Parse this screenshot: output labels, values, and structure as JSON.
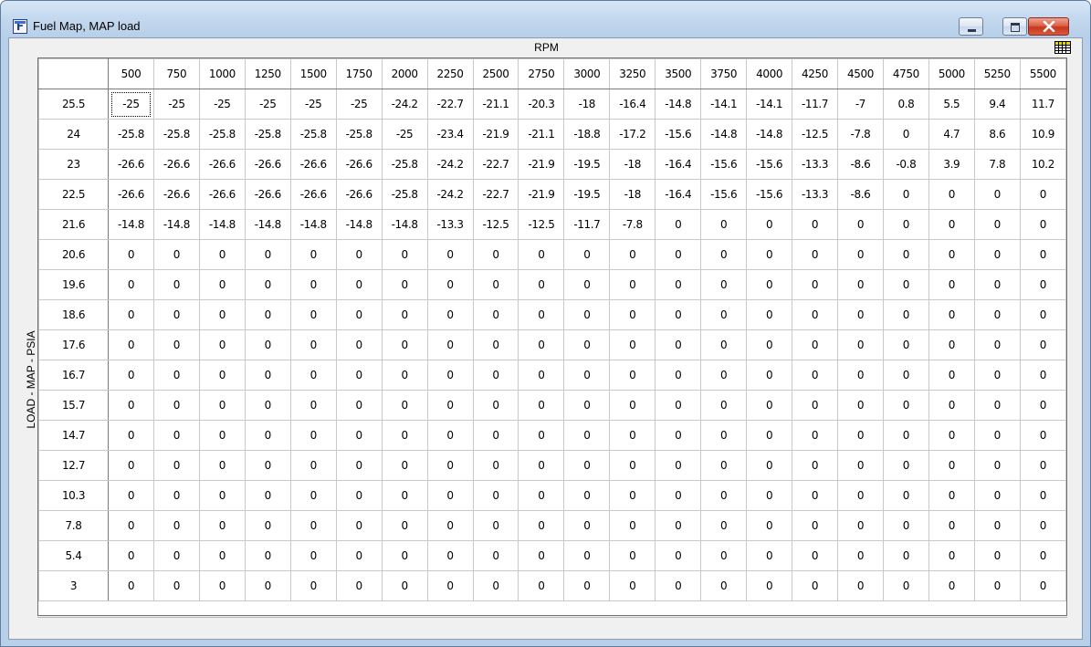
{
  "window": {
    "title": "Fuel Map, MAP load",
    "icon": "F-app-icon"
  },
  "controls": {
    "minimize": "minimize-icon",
    "maximize": "maximize-icon",
    "close": "close-icon"
  },
  "table": {
    "x_axis_label": "RPM",
    "y_axis_label": "LOAD - MAP - PSIA",
    "columns": [
      "500",
      "750",
      "1000",
      "1250",
      "1500",
      "1750",
      "2000",
      "2250",
      "2500",
      "2750",
      "3000",
      "3250",
      "3500",
      "3750",
      "4000",
      "4250",
      "4500",
      "4750",
      "5000",
      "5250",
      "5500"
    ],
    "rows": [
      {
        "load": "25.5",
        "values": [
          "-25",
          "-25",
          "-25",
          "-25",
          "-25",
          "-25",
          "-24.2",
          "-22.7",
          "-21.1",
          "-20.3",
          "-18",
          "-16.4",
          "-14.8",
          "-14.1",
          "-14.1",
          "-11.7",
          "-7",
          "0.8",
          "5.5",
          "9.4",
          "11.7"
        ]
      },
      {
        "load": "24",
        "values": [
          "-25.8",
          "-25.8",
          "-25.8",
          "-25.8",
          "-25.8",
          "-25.8",
          "-25",
          "-23.4",
          "-21.9",
          "-21.1",
          "-18.8",
          "-17.2",
          "-15.6",
          "-14.8",
          "-14.8",
          "-12.5",
          "-7.8",
          "0",
          "4.7",
          "8.6",
          "10.9"
        ]
      },
      {
        "load": "23",
        "values": [
          "-26.6",
          "-26.6",
          "-26.6",
          "-26.6",
          "-26.6",
          "-26.6",
          "-25.8",
          "-24.2",
          "-22.7",
          "-21.9",
          "-19.5",
          "-18",
          "-16.4",
          "-15.6",
          "-15.6",
          "-13.3",
          "-8.6",
          "-0.8",
          "3.9",
          "7.8",
          "10.2"
        ]
      },
      {
        "load": "22.5",
        "values": [
          "-26.6",
          "-26.6",
          "-26.6",
          "-26.6",
          "-26.6",
          "-26.6",
          "-25.8",
          "-24.2",
          "-22.7",
          "-21.9",
          "-19.5",
          "-18",
          "-16.4",
          "-15.6",
          "-15.6",
          "-13.3",
          "-8.6",
          "0",
          "0",
          "0",
          "0"
        ]
      },
      {
        "load": "21.6",
        "values": [
          "-14.8",
          "-14.8",
          "-14.8",
          "-14.8",
          "-14.8",
          "-14.8",
          "-14.8",
          "-13.3",
          "-12.5",
          "-12.5",
          "-11.7",
          "-7.8",
          "0",
          "0",
          "0",
          "0",
          "0",
          "0",
          "0",
          "0",
          "0"
        ]
      },
      {
        "load": "20.6",
        "values": [
          "0",
          "0",
          "0",
          "0",
          "0",
          "0",
          "0",
          "0",
          "0",
          "0",
          "0",
          "0",
          "0",
          "0",
          "0",
          "0",
          "0",
          "0",
          "0",
          "0",
          "0"
        ]
      },
      {
        "load": "19.6",
        "values": [
          "0",
          "0",
          "0",
          "0",
          "0",
          "0",
          "0",
          "0",
          "0",
          "0",
          "0",
          "0",
          "0",
          "0",
          "0",
          "0",
          "0",
          "0",
          "0",
          "0",
          "0"
        ]
      },
      {
        "load": "18.6",
        "values": [
          "0",
          "0",
          "0",
          "0",
          "0",
          "0",
          "0",
          "0",
          "0",
          "0",
          "0",
          "0",
          "0",
          "0",
          "0",
          "0",
          "0",
          "0",
          "0",
          "0",
          "0"
        ]
      },
      {
        "load": "17.6",
        "values": [
          "0",
          "0",
          "0",
          "0",
          "0",
          "0",
          "0",
          "0",
          "0",
          "0",
          "0",
          "0",
          "0",
          "0",
          "0",
          "0",
          "0",
          "0",
          "0",
          "0",
          "0"
        ]
      },
      {
        "load": "16.7",
        "values": [
          "0",
          "0",
          "0",
          "0",
          "0",
          "0",
          "0",
          "0",
          "0",
          "0",
          "0",
          "0",
          "0",
          "0",
          "0",
          "0",
          "0",
          "0",
          "0",
          "0",
          "0"
        ]
      },
      {
        "load": "15.7",
        "values": [
          "0",
          "0",
          "0",
          "0",
          "0",
          "0",
          "0",
          "0",
          "0",
          "0",
          "0",
          "0",
          "0",
          "0",
          "0",
          "0",
          "0",
          "0",
          "0",
          "0",
          "0"
        ]
      },
      {
        "load": "14.7",
        "values": [
          "0",
          "0",
          "0",
          "0",
          "0",
          "0",
          "0",
          "0",
          "0",
          "0",
          "0",
          "0",
          "0",
          "0",
          "0",
          "0",
          "0",
          "0",
          "0",
          "0",
          "0"
        ]
      },
      {
        "load": "12.7",
        "values": [
          "0",
          "0",
          "0",
          "0",
          "0",
          "0",
          "0",
          "0",
          "0",
          "0",
          "0",
          "0",
          "0",
          "0",
          "0",
          "0",
          "0",
          "0",
          "0",
          "0",
          "0"
        ]
      },
      {
        "load": "10.3",
        "values": [
          "0",
          "0",
          "0",
          "0",
          "0",
          "0",
          "0",
          "0",
          "0",
          "0",
          "0",
          "0",
          "0",
          "0",
          "0",
          "0",
          "0",
          "0",
          "0",
          "0",
          "0"
        ]
      },
      {
        "load": "7.8",
        "values": [
          "0",
          "0",
          "0",
          "0",
          "0",
          "0",
          "0",
          "0",
          "0",
          "0",
          "0",
          "0",
          "0",
          "0",
          "0",
          "0",
          "0",
          "0",
          "0",
          "0",
          "0"
        ]
      },
      {
        "load": "5.4",
        "values": [
          "0",
          "0",
          "0",
          "0",
          "0",
          "0",
          "0",
          "0",
          "0",
          "0",
          "0",
          "0",
          "0",
          "0",
          "0",
          "0",
          "0",
          "0",
          "0",
          "0",
          "0"
        ]
      },
      {
        "load": "3",
        "values": [
          "0",
          "0",
          "0",
          "0",
          "0",
          "0",
          "0",
          "0",
          "0",
          "0",
          "0",
          "0",
          "0",
          "0",
          "0",
          "0",
          "0",
          "0",
          "0",
          "0",
          "0"
        ]
      }
    ]
  }
}
